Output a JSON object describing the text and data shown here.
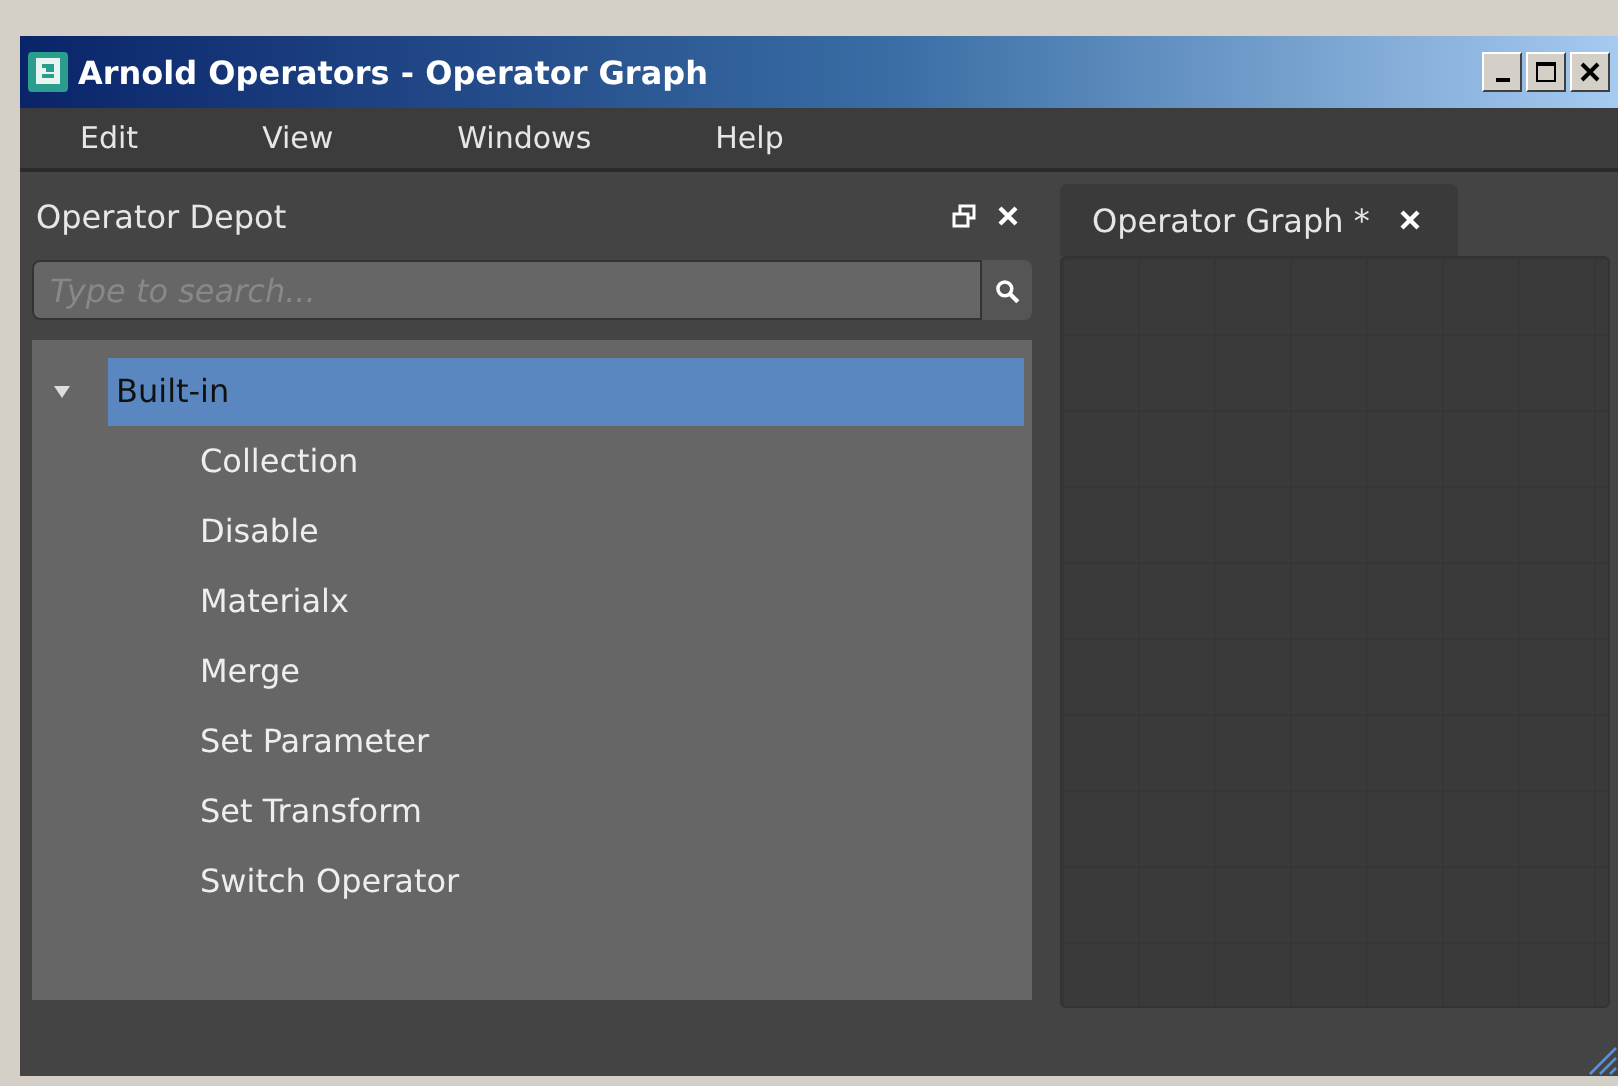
{
  "window": {
    "title": "Arnold Operators - Operator Graph"
  },
  "menu": [
    "Edit",
    "View",
    "Windows",
    "Help"
  ],
  "depot": {
    "title": "Operator Depot",
    "search": {
      "placeholder": "Type to search..."
    },
    "tree": [
      {
        "label": "Built-in",
        "expanded": true,
        "selected": true,
        "children": [
          {
            "label": "Collection",
            "selected": false
          },
          {
            "label": "Disable",
            "selected": false
          },
          {
            "label": "Materialx",
            "selected": false
          },
          {
            "label": "Merge",
            "selected": false
          },
          {
            "label": "Set Parameter",
            "selected": false
          },
          {
            "label": "Set Transform",
            "selected": false
          },
          {
            "label": "Switch Operator",
            "selected": false
          }
        ]
      }
    ]
  },
  "tabs": [
    {
      "label": "Operator Graph *",
      "selected": true
    }
  ]
}
